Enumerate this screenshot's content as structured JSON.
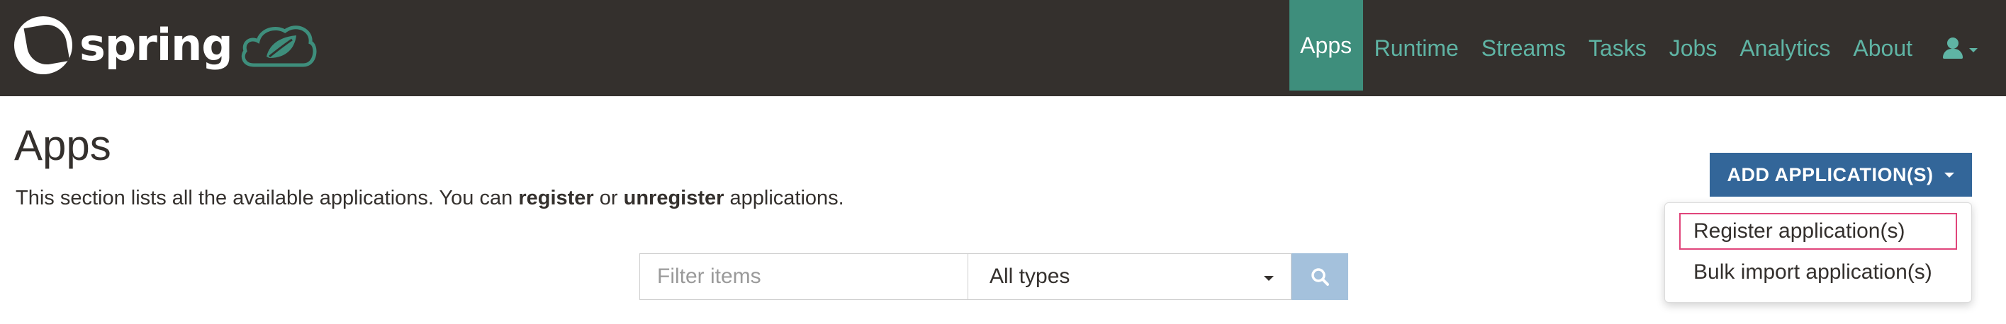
{
  "brand": {
    "logo_icon": "spring-leaf-icon",
    "wordmark": "spring",
    "cloud_icon": "spring-cloud-leaf-icon"
  },
  "nav": {
    "items": [
      {
        "label": "Apps",
        "active": true
      },
      {
        "label": "Runtime"
      },
      {
        "label": "Streams"
      },
      {
        "label": "Tasks"
      },
      {
        "label": "Jobs"
      },
      {
        "label": "Analytics"
      },
      {
        "label": "About"
      }
    ],
    "user_icon": "user-icon"
  },
  "page": {
    "title": "Apps",
    "desc_prefix": "This section lists all the available applications. You can ",
    "desc_register": "register",
    "desc_or": " or ",
    "desc_unregister": "unregister",
    "desc_suffix": " applications."
  },
  "actions": {
    "add_label": "ADD APPLICATION(S)",
    "menu": [
      "Register application(s)",
      "Bulk import application(s)"
    ]
  },
  "filter": {
    "placeholder": "Filter items",
    "type_value": "All types",
    "search_icon": "search-icon"
  },
  "colors": {
    "navbar_bg": "#34302d",
    "nav_link": "#5fb4a4",
    "nav_active_bg": "#3e8e7c",
    "button_primary": "#336699",
    "search_button": "#a4c1dc",
    "highlight_border": "#e0457b"
  }
}
